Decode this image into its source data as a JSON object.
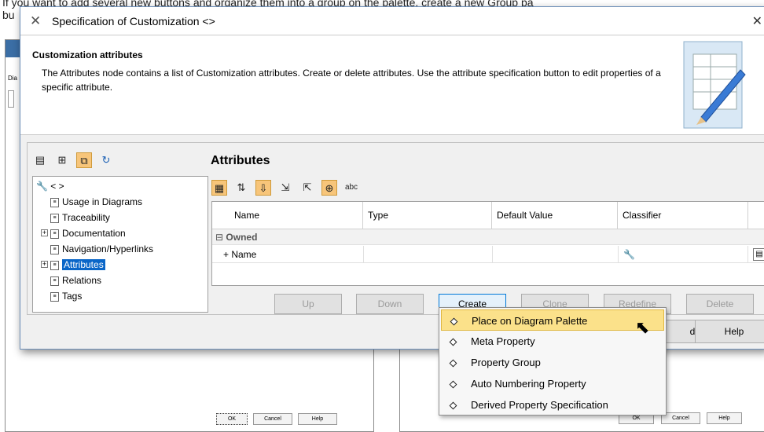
{
  "page": {
    "bg_text_line1": "If you want to add several new buttons and organize them into a group on the palette, create a new Group pa",
    "bg_text_line2": "bu"
  },
  "background_windows": {
    "left_title_fragment": "Dia",
    "ok": "OK",
    "cancel": "Cancel",
    "help": "Help"
  },
  "dialog": {
    "title": "Specification of Customization <>",
    "header_title": "Customization attributes",
    "header_desc": "The Attributes node contains a list of Customization attributes. Create or delete attributes. Use the attribute specification button to edit properties of a specific attribute.",
    "section_title": "Attributes",
    "tree": {
      "root": "< >",
      "items": [
        {
          "label": "Usage in Diagrams",
          "expandable": false
        },
        {
          "label": "Traceability",
          "expandable": false
        },
        {
          "label": "Documentation",
          "expandable": true
        },
        {
          "label": "Navigation/Hyperlinks",
          "expandable": false
        },
        {
          "label": "Attributes",
          "expandable": true,
          "selected": true
        },
        {
          "label": "Relations",
          "expandable": false
        },
        {
          "label": "Tags",
          "expandable": false
        }
      ]
    },
    "grid": {
      "columns": [
        "Name",
        "Type",
        "Default Value",
        "Classifier"
      ],
      "group": "Owned",
      "rows": [
        {
          "name": "+ Name",
          "type": "",
          "default": "",
          "classifier": ""
        }
      ]
    },
    "buttons": {
      "up": "Up",
      "down": "Down",
      "create": "Create",
      "clone": "Clone",
      "redefine": "Redefine",
      "delete": "Delete",
      "close_fragment": "d",
      "help": "Help"
    }
  },
  "create_menu": {
    "items": [
      "Place on Diagram Palette",
      "Meta Property",
      "Property Group",
      "Auto Numbering Property",
      "Derived Property Specification"
    ],
    "highlighted": "Place on Diagram Palette",
    "highlight_color": "#fbe18a"
  }
}
